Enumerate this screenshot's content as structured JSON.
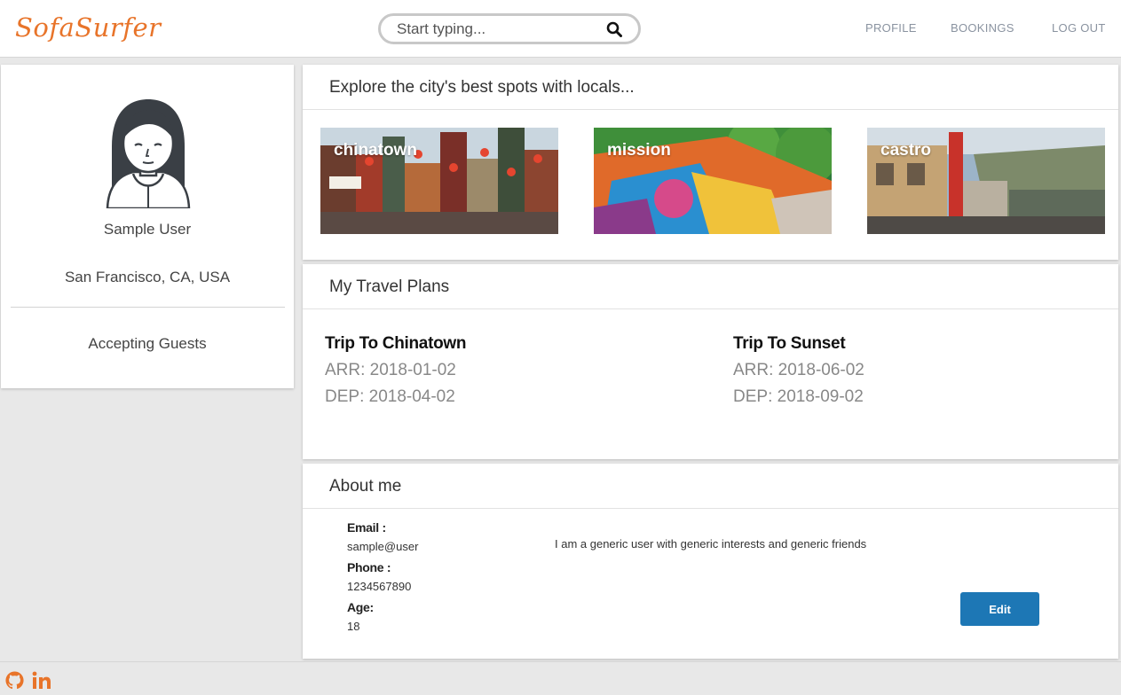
{
  "header": {
    "logo": "SofaSurfer",
    "search_placeholder": "Start typing...",
    "nav": [
      "PROFILE",
      "BOOKINGS",
      "LOG OUT"
    ]
  },
  "profile": {
    "name": "Sample User",
    "location": "San Francisco, CA, USA",
    "status": "Accepting Guests"
  },
  "explore": {
    "title": "Explore the city's best spots with locals...",
    "spots": [
      {
        "name": "chinatown"
      },
      {
        "name": "mission"
      },
      {
        "name": "castro"
      }
    ]
  },
  "plans": {
    "title": "My Travel Plans",
    "trips": [
      {
        "name": "Trip To Chinatown",
        "arr": "ARR: 2018-01-02",
        "dep": "DEP: 2018-04-02"
      },
      {
        "name": "Trip To Sunset",
        "arr": "ARR: 2018-06-02",
        "dep": "DEP: 2018-09-02"
      }
    ]
  },
  "about": {
    "title": "About me",
    "email_label": "Email :",
    "email": "sample@user",
    "phone_label": "Phone :",
    "phone": "1234567890",
    "age_label": "Age:",
    "age": "18",
    "bio": "I am a generic user with generic interests and generic friends",
    "edit_label": "Edit"
  },
  "colors": {
    "brand_orange": "#e8742a",
    "button_blue": "#1d77b5"
  }
}
